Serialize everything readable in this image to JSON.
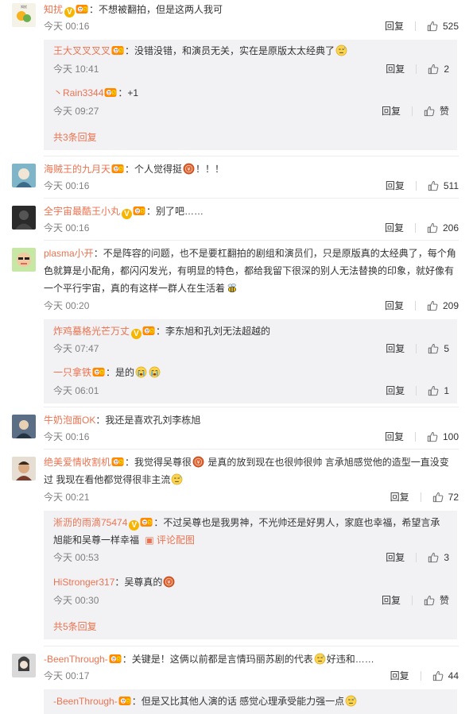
{
  "comments": [
    {
      "user": "知扰",
      "colon": "：",
      "text": "不想被翻拍，但是这两人我可",
      "time": "今天 00:16",
      "reply": "回复",
      "likes": "525",
      "replies": [
        {
          "user": "王大叉叉叉叉",
          "colon": "：",
          "text": "没错没错，和演员无关，实在是原版太太经典了",
          "time": "今天 10:41",
          "reply": "回复",
          "likes": "2"
        },
        {
          "user": "丶Rain3344",
          "colon": "：",
          "text": "+1",
          "time": "今天 09:27",
          "reply": "回复",
          "likes": "赞"
        }
      ],
      "more": "共3条回复"
    },
    {
      "user": "海贼王的九月天",
      "colon": "：",
      "text_a": "个人觉得挺",
      "text_b": "！！！",
      "time": "今天 00:16",
      "reply": "回复",
      "likes": "511"
    },
    {
      "user": "全宇宙最酷王小丸",
      "colon": "：",
      "text": "别了吧……",
      "time": "今天 00:16",
      "reply": "回复",
      "likes": "206"
    },
    {
      "user": "plasma小开",
      "colon": "：",
      "text_l1": "不是阵容的问题，也不是要杠翻拍的剧组和演员们，只是原版真的太经典了，每个角",
      "text_l2": "色就算是小配角，都闪闪发光，有明显的特色，都给我留下很深的别人无法替换的印象，就好像有",
      "text_l3": "一个平行宇宙，真的有这样一群人在生活着",
      "time": "今天 00:20",
      "reply": "回复",
      "likes": "209",
      "replies": [
        {
          "user": "炸鸡墓格光芒万丈",
          "colon": "：",
          "text": "李东旭和孔刘无法超越的",
          "time": "今天 07:47",
          "reply": "回复",
          "likes": "5"
        },
        {
          "user": "一只拿铁",
          "colon": "：",
          "text": "是的",
          "time": "今天 06:01",
          "reply": "回复",
          "likes": "1"
        }
      ]
    },
    {
      "user": "牛奶泡面OK",
      "colon": "：",
      "text": "我还是喜欢孔刘李栋旭",
      "time": "今天 00:16",
      "reply": "回复",
      "likes": "100"
    },
    {
      "user": "绝美爱情收割机",
      "colon": "：",
      "text_l1a": "我觉得吴尊很",
      "text_l1b": "是真的放到现在也很帅很帅 言承旭感觉他的造型一直没变",
      "text_l2": "过 我现在看他都觉得很非主流",
      "time": "今天 00:21",
      "reply": "回复",
      "likes": "72",
      "replies": [
        {
          "user": "淅沥的雨滴75474",
          "colon": "：",
          "text_l1": "不过吴尊也是我男神，不光帅还是好男人，家庭也幸福，希望言承",
          "text_l2": "旭能和吴尊一样幸福",
          "pic": "评论配图",
          "time": "今天 00:53",
          "reply": "回复",
          "likes": "3"
        },
        {
          "user": "HiStronger317",
          "colon": "：",
          "text": "吴尊真的",
          "time": "今天 00:30",
          "reply": "回复",
          "likes": "赞"
        }
      ],
      "more": "共5条回复"
    },
    {
      "user": "-BeenThrough-",
      "colon": "：",
      "text_a": "关键是！这俩以前都是言情玛丽苏剧的代表",
      "text_b": "好违和……",
      "time": "今天 00:17",
      "reply": "回复",
      "likes": "44",
      "replies": [
        {
          "user": "-BeenThrough-",
          "colon": "：",
          "text": "但是又比其他人演的话 感觉心理承受能力强一点"
        }
      ]
    }
  ],
  "colors": {
    "username": "#eb7350",
    "meta": "#808080",
    "subbox_bg": "#f2f2f5",
    "badge_gold": "#f7b500"
  }
}
